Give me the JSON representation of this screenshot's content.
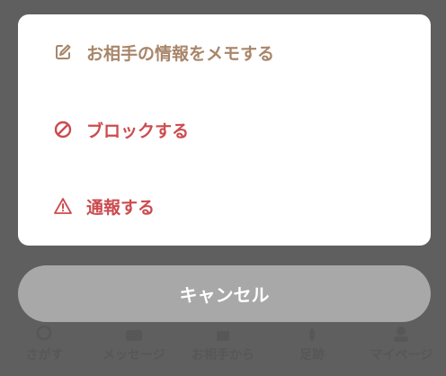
{
  "action_sheet": {
    "items": [
      {
        "label": "お相手の情報をメモする",
        "icon": "edit-icon",
        "color": "#a8866a"
      },
      {
        "label": "ブロックする",
        "icon": "block-icon",
        "color": "#cc4b4e"
      },
      {
        "label": "通報する",
        "icon": "warning-icon",
        "color": "#cc4b4e"
      }
    ],
    "cancel_label": "キャンセル"
  },
  "tabbar": {
    "tabs": [
      {
        "label": "さがす",
        "icon": "search-icon"
      },
      {
        "label": "メッセージ",
        "icon": "message-icon"
      },
      {
        "label": "お相手から",
        "icon": "inbox-icon"
      },
      {
        "label": "足跡",
        "icon": "footprint-icon"
      },
      {
        "label": "マイページ",
        "icon": "person-icon"
      }
    ]
  },
  "colors": {
    "overlay": "#5f5f5f",
    "memo_accent": "#a8866a",
    "danger": "#cc4b4e",
    "cancel_bg": "#a8a8a8"
  }
}
